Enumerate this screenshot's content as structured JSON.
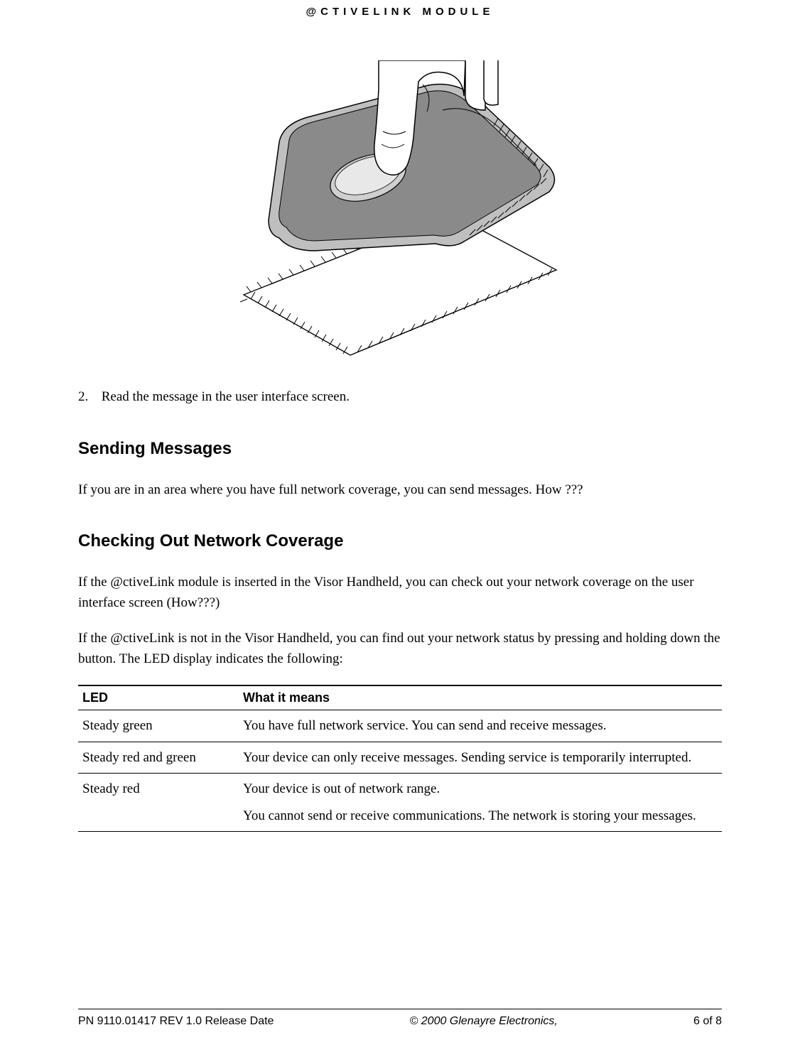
{
  "header": {
    "title": "@CTIVELINK  MODULE"
  },
  "step": {
    "number": "2.",
    "text": "Read the message in the user interface screen."
  },
  "sections": {
    "sending": {
      "heading": "Sending Messages",
      "para1": "If you are in an area where you have full network coverage, you can send messages. How ???"
    },
    "coverage": {
      "heading": "Checking Out Network Coverage",
      "para1": "If the @ctiveLink module is inserted in the Visor Handheld, you can check out your network coverage on the user interface screen (How???)",
      "para2": "If the @ctiveLink is not in the Visor Handheld, you can find out your network status by pressing and holding down the button. The LED display indicates the following:"
    }
  },
  "table": {
    "headers": {
      "c1": "LED",
      "c2": "What it means"
    },
    "rows": [
      {
        "led": "Steady green",
        "meaning": "You have full network service. You can send and receive messages."
      },
      {
        "led": "Steady red and green",
        "meaning": "Your device can only receive messages. Sending service is temporarily interrupted."
      },
      {
        "led": "Steady red",
        "meaning_p1": "Your device is out of network range.",
        "meaning_p2": "You cannot send or receive communications. The network is storing your messages."
      }
    ]
  },
  "footer": {
    "left": "PN 9110.01417 REV 1.0 Release Date",
    "center": "© 2000 Glenayre Electronics,",
    "right": "6 of 8"
  }
}
